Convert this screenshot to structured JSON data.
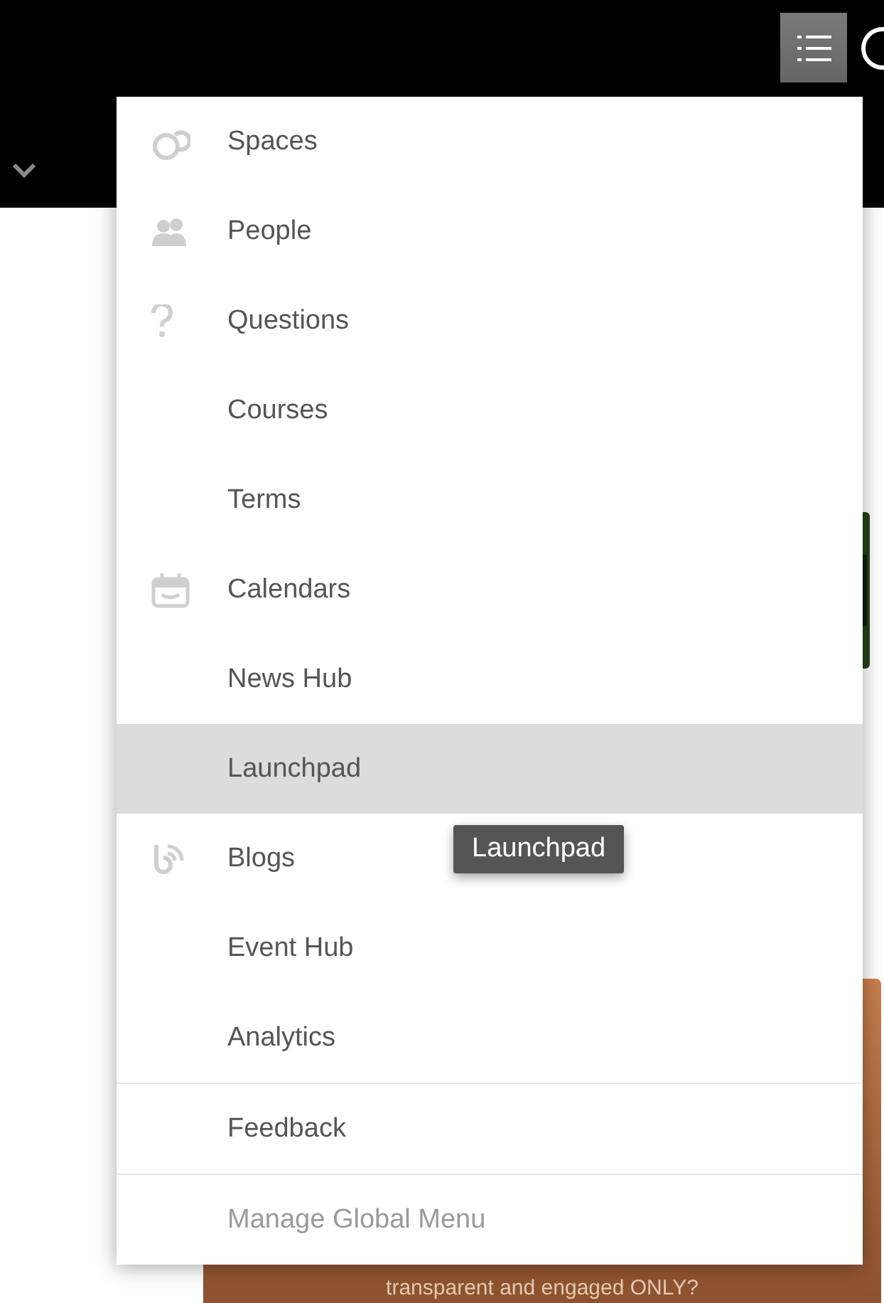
{
  "menu": {
    "sections": [
      {
        "items": [
          {
            "label": "Spaces",
            "kind": "ring",
            "selected": false
          },
          {
            "label": "People",
            "kind": "people",
            "selected": false
          },
          {
            "label": "Questions",
            "kind": "question",
            "selected": false
          },
          {
            "label": "Courses",
            "kind": "plain",
            "selected": false
          },
          {
            "label": "Terms",
            "kind": "plain",
            "selected": false
          },
          {
            "label": "Calendars",
            "kind": "calendar",
            "selected": false
          },
          {
            "label": "News Hub",
            "kind": "plain",
            "selected": false
          },
          {
            "label": "Launchpad",
            "kind": "plain",
            "selected": true
          },
          {
            "label": "Blogs",
            "kind": "feed",
            "selected": false
          },
          {
            "label": "Event Hub",
            "kind": "plain",
            "selected": false
          },
          {
            "label": "Analytics",
            "kind": "plain",
            "selected": false
          }
        ]
      },
      {
        "items": [
          {
            "label": "Feedback",
            "kind": "plain",
            "selected": false
          }
        ]
      },
      {
        "items": [
          {
            "label": "Manage Global Menu",
            "kind": "admin",
            "selected": false
          }
        ]
      }
    ]
  },
  "tooltip": "Launchpad",
  "banner": {
    "text": "transparent and engaged ONLY?"
  }
}
